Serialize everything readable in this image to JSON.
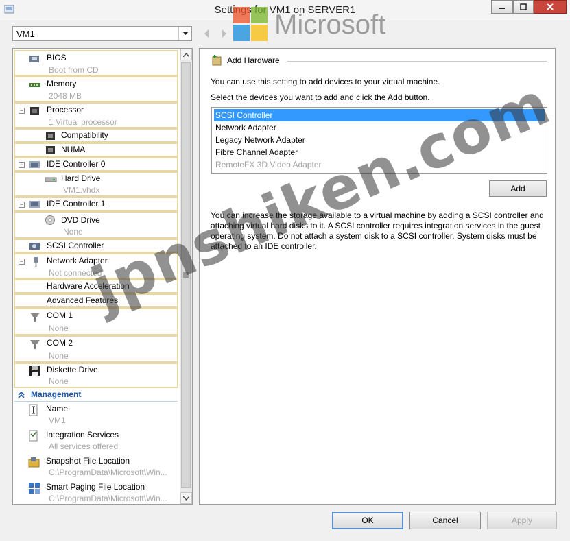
{
  "window": {
    "title": "Settings for VM1 on SERVER1",
    "watermark_logo_text": "Microsoft",
    "watermark_text": "jpnshiken.com"
  },
  "vm_selector": {
    "value": "VM1"
  },
  "hardware": [
    {
      "label": "BIOS",
      "sub": "Boot from CD",
      "icon": "bios-icon"
    },
    {
      "label": "Memory",
      "sub": "2048 MB",
      "icon": "memory-icon"
    },
    {
      "label": "Processor",
      "sub": "1 Virtual processor",
      "icon": "processor-icon"
    },
    {
      "label": "Compatibility",
      "icon": "chip-icon"
    },
    {
      "label": "NUMA",
      "icon": "chip-icon"
    },
    {
      "label": "IDE Controller 0",
      "icon": "ide-controller-icon"
    },
    {
      "label": "Hard Drive",
      "sub": "VM1.vhdx",
      "icon": "hard-drive-icon"
    },
    {
      "label": "IDE Controller 1",
      "icon": "ide-controller-icon"
    },
    {
      "label": "DVD Drive",
      "sub": "None",
      "icon": "dvd-icon"
    },
    {
      "label": "SCSI Controller",
      "icon": "scsi-icon"
    },
    {
      "label": "Network Adapter",
      "sub": "Not connected",
      "icon": "network-adapter-icon"
    },
    {
      "label": "Hardware Acceleration"
    },
    {
      "label": "Advanced Features"
    },
    {
      "label": "COM 1",
      "sub": "None",
      "icon": "com-port-icon"
    },
    {
      "label": "COM 2",
      "sub": "None",
      "icon": "com-port-icon"
    },
    {
      "label": "Diskette Drive",
      "sub": "None",
      "icon": "diskette-icon"
    }
  ],
  "management": {
    "header": "Management",
    "items": [
      {
        "label": "Name",
        "sub": "VM1",
        "icon": "name-icon"
      },
      {
        "label": "Integration Services",
        "sub": "All services offered",
        "icon": "integration-services-icon"
      },
      {
        "label": "Snapshot File Location",
        "sub": "C:\\ProgramData\\Microsoft\\Win...",
        "icon": "snapshot-icon"
      },
      {
        "label": "Smart Paging File Location",
        "sub": "C:\\ProgramData\\Microsoft\\Win...",
        "icon": "smart-paging-icon"
      }
    ]
  },
  "add_hardware": {
    "title": "Add Hardware",
    "description": "You can use this setting to add devices to your virtual machine.",
    "instruction": "Select the devices you want to add and click the Add button.",
    "devices": [
      {
        "label": "SCSI Controller",
        "selected": true,
        "disabled": false
      },
      {
        "label": "Network Adapter",
        "selected": false,
        "disabled": false
      },
      {
        "label": "Legacy Network Adapter",
        "selected": false,
        "disabled": false
      },
      {
        "label": "Fibre Channel Adapter",
        "selected": false,
        "disabled": false
      },
      {
        "label": "RemoteFX 3D Video Adapter",
        "selected": false,
        "disabled": true
      }
    ],
    "add_label": "Add",
    "info": "You can increase the storage available to a virtual machine by adding a SCSI controller and attaching virtual hard disks to it. A SCSI controller requires integration services in the guest operating system. Do not attach a system disk to a SCSI controller. System disks must be attached to an IDE controller."
  },
  "buttons": {
    "ok": "OK",
    "cancel": "Cancel",
    "apply": "Apply"
  },
  "colors": {
    "selection": "#3399ff",
    "accent_border": "#e8d7a6",
    "close_button": "#c9463d",
    "management_header": "#1e57a8"
  }
}
